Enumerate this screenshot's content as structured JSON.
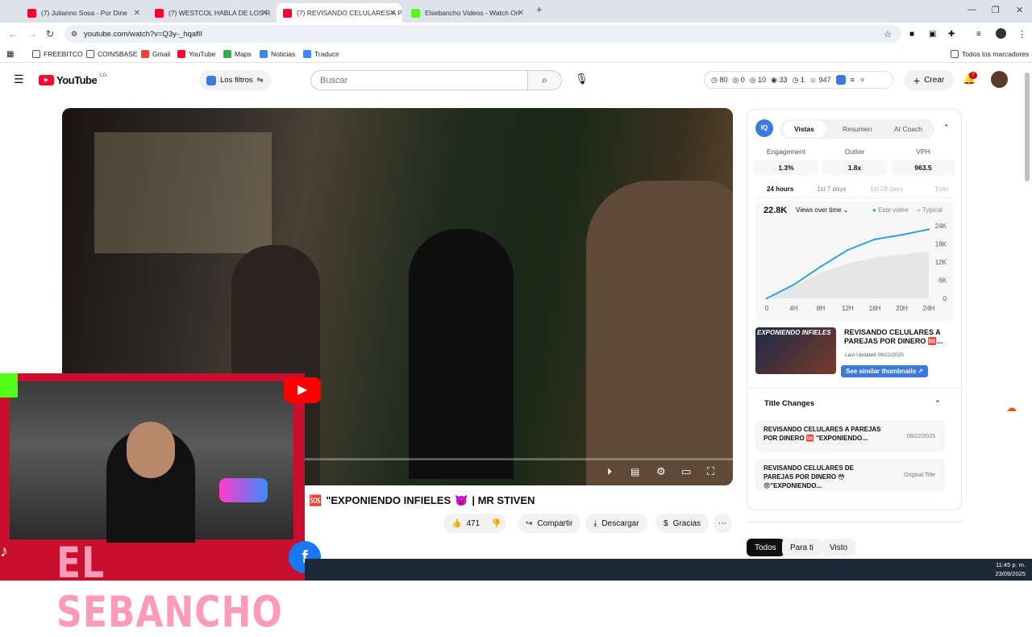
{
  "tabs": [
    {
      "title": "(7) Julianno Sosa - Por Dine",
      "active": false,
      "color": "#ff0033"
    },
    {
      "title": "(7) WESTCOL HABLA DE LOS R",
      "active": false,
      "color": "#ff0033"
    },
    {
      "title": "(7) REVISANDO CELULARES A P",
      "active": true,
      "color": "#ff0033"
    },
    {
      "title": "Elsebancho Videos - Watch On",
      "active": false,
      "color": "#53fc18"
    }
  ],
  "address": "youtube.com/watch?v=Q3y-_hqafII",
  "bookmarks": [
    "FREEBITCO",
    "COINSBASE",
    "Gmail",
    "YouTube",
    "Maps",
    "Noticias",
    "Traducir"
  ],
  "bookmarks_all": "Todos los marcadores",
  "yt": {
    "logo": "YouTube",
    "country": "CO",
    "filters": "Los filtros",
    "search_placeholder": "Buscar",
    "create": "Crear",
    "notif_count": "7",
    "stats": [
      "80",
      "0",
      "10",
      "33",
      "1",
      "947"
    ]
  },
  "video": {
    "title": "\"EXPONIENDO INFIELES",
    "title_suffix": "| MR STIVEN",
    "likes": "471",
    "share": "Compartir",
    "download": "Descargar",
    "thanks": "Gracias"
  },
  "streamer": {
    "name": "EL SEBANCHO"
  },
  "chips": [
    "Todos",
    "Para ti",
    "Visto"
  ],
  "panel": {
    "tabs": [
      "Vistas",
      "Resumen",
      "AI Coach"
    ],
    "metrics": [
      {
        "label": "Engagement",
        "value": "1.3%"
      },
      {
        "label": "Outlier",
        "value": "1.8x"
      },
      {
        "label": "VPH",
        "value": "963.5"
      }
    ],
    "ranges": [
      "24 hours",
      "1st 7 days",
      "1st 28 days",
      "Todo"
    ],
    "views": "22.8K",
    "views_dropdown": "Views over time",
    "legend_this": "Este video",
    "legend_typical": "Typical",
    "thumb_text": "EXPONIENDO INFIELES",
    "video_title": "REVISANDO CELULARES A PAREJAS POR DINERO 🆘...",
    "last_updated": "Last Updated 09/22/2025",
    "similar": "See similar thumbnails",
    "title_changes_header": "Title Changes",
    "title_changes": [
      {
        "text": "REVISANDO CELULARES A PAREJAS POR DINERO 🆘 \"EXPONIENDO...",
        "date": "09/22/2025"
      },
      {
        "text": "REVISANDO CELULARES DE PAREJAS POR DINERO 😳😨\"EXPONIENDO...",
        "date": "Original Title"
      }
    ]
  },
  "chart_data": {
    "type": "line",
    "x": [
      "0",
      "4H",
      "8H",
      "12H",
      "16H",
      "20H",
      "24H"
    ],
    "yticks": [
      "24K",
      "18K",
      "12K",
      "6K",
      "0"
    ],
    "ylim": [
      0,
      24000
    ],
    "series": [
      {
        "name": "Este video",
        "values": [
          0,
          4500,
          10500,
          16000,
          19500,
          21000,
          22800
        ],
        "color": "#2fa4dc"
      },
      {
        "name": "Typical",
        "values": [
          0,
          4000,
          8500,
          11500,
          13500,
          14500,
          15500
        ],
        "color": "#d8d8d8"
      }
    ]
  },
  "clock": {
    "time": "11:45 p. m.",
    "date": "23/09/2025"
  }
}
